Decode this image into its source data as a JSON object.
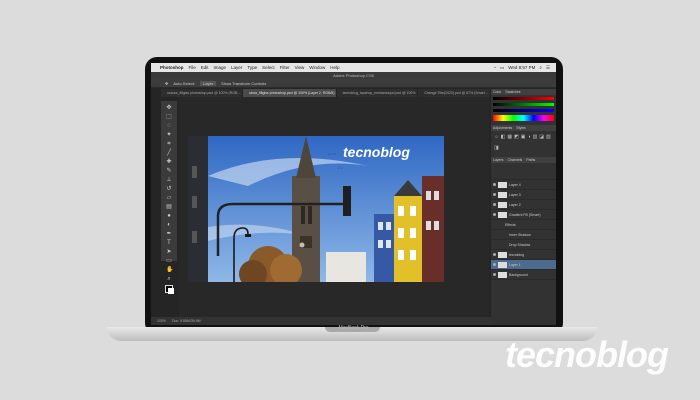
{
  "menubar": {
    "items": [
      "Photoshop",
      "File",
      "Edit",
      "Image",
      "Layer",
      "Type",
      "Select",
      "Filter",
      "View",
      "Window",
      "Help"
    ],
    "clock": "Wed 8:57 PM"
  },
  "ps": {
    "title": "Adobe Photoshop CS6",
    "options": [
      "Auto-Select:",
      "Layer",
      "Show Transform Controls"
    ],
    "tabs": [
      "oscura_filtgiss photoshop.psd @ 100% (RGB...",
      "otura_filtgiss photoshop.psd @ 100% (Layer 2, RGB/8)",
      "tecnoblog_topshop_mediaotoopd.psd @ 100%",
      "Change Title(2020).psd @ 67% (Smart..."
    ],
    "status": [
      "100%",
      "Doc: 9.85M/39.9M"
    ]
  },
  "panels": {
    "color_tabs": [
      "Color",
      "Swatches"
    ],
    "adjust_tabs": [
      "Adjustments",
      "Styles"
    ],
    "layers_tabs": [
      "Layers",
      "Channels",
      "Paths"
    ],
    "layers": [
      "Layer 4",
      "Layer 3",
      "Layer 2",
      "Gradient Fill (Smart)",
      "Effects",
      "Inner Shadow",
      "Drop Shadow",
      "tecnoblog",
      "Layer 1",
      "Background"
    ]
  },
  "image": {
    "watermark_in_photo": "tecnoblog"
  },
  "bezel": {
    "label": "MacBook Pro"
  },
  "watermark": {
    "text": "tecnoblog"
  }
}
